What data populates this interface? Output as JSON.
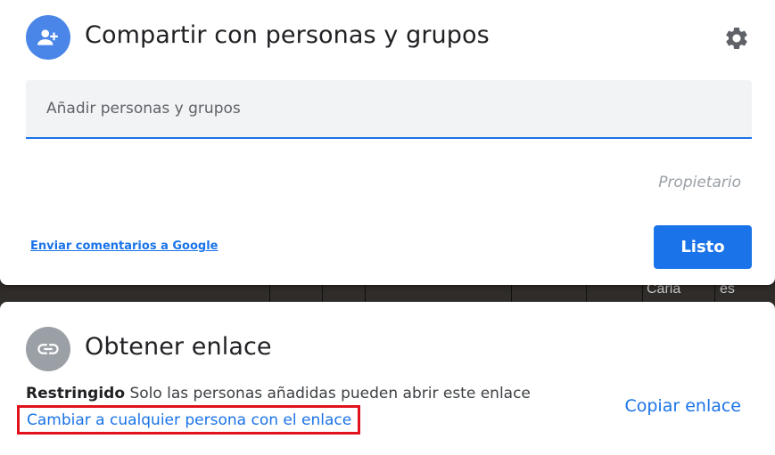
{
  "background": {
    "cells": [
      "Carla",
      "es"
    ]
  },
  "share": {
    "title": "Compartir con personas y grupos",
    "avatar_icon": "person-add-icon",
    "settings_icon": "gear-icon",
    "search_placeholder": "Añadir personas y grupos",
    "owner_role": "Propietario",
    "feedback_link": "Enviar comentarios a Google",
    "done_button": "Listo"
  },
  "link": {
    "title": "Obtener enlace",
    "avatar_icon": "link-icon",
    "restricted_label": "Restringido",
    "restricted_desc": "Solo las personas añadidas pueden abrir este enlace",
    "change_link": "Cambiar a cualquier persona con el enlace",
    "copy_link": "Copiar enlace"
  },
  "colors": {
    "accent": "#1a73e8",
    "highlight_border": "#e0121c",
    "share_avatar": "#4a86e8",
    "link_avatar": "#9aa0a6"
  }
}
